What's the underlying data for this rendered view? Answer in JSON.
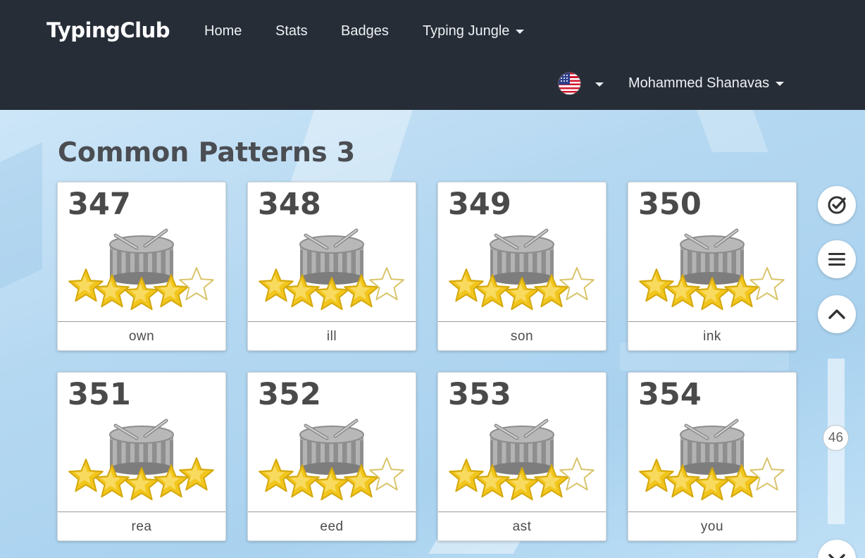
{
  "nav": {
    "brand": "TypingClub",
    "links": [
      {
        "label": "Home"
      },
      {
        "label": "Stats"
      },
      {
        "label": "Badges"
      },
      {
        "label": "Typing Jungle",
        "dropdown": true
      }
    ],
    "language_icon": "us-flag-icon",
    "user_name": "Mohammed Shanavas"
  },
  "page": {
    "title": "Common Patterns 3"
  },
  "lessons": [
    {
      "number": "347",
      "word": "own",
      "stars": 4,
      "max_stars": 5,
      "icon": "drum-icon"
    },
    {
      "number": "348",
      "word": "ill",
      "stars": 4,
      "max_stars": 5,
      "icon": "drum-icon"
    },
    {
      "number": "349",
      "word": "son",
      "stars": 4,
      "max_stars": 5,
      "icon": "drum-icon"
    },
    {
      "number": "350",
      "word": "ink",
      "stars": 4,
      "max_stars": 5,
      "icon": "drum-icon"
    },
    {
      "number": "351",
      "word": "rea",
      "stars": 5,
      "max_stars": 5,
      "icon": "drum-icon"
    },
    {
      "number": "352",
      "word": "eed",
      "stars": 4,
      "max_stars": 5,
      "icon": "drum-icon"
    },
    {
      "number": "353",
      "word": "ast",
      "stars": 4,
      "max_stars": 5,
      "icon": "drum-icon"
    },
    {
      "number": "354",
      "word": "you",
      "stars": 4,
      "max_stars": 5,
      "icon": "drum-icon"
    }
  ],
  "sidebar_tools": {
    "buttons": [
      {
        "icon": "check-circle-icon"
      },
      {
        "icon": "menu-icon"
      },
      {
        "icon": "chevron-up-icon"
      },
      {
        "icon": "chevron-down-icon"
      }
    ],
    "scroll_value": "46"
  },
  "colors": {
    "nav_bg": "#262d37",
    "star_gold": "#f2c61c",
    "star_outline": "#d4a80c",
    "drum_gray": "#9a9a9a"
  }
}
